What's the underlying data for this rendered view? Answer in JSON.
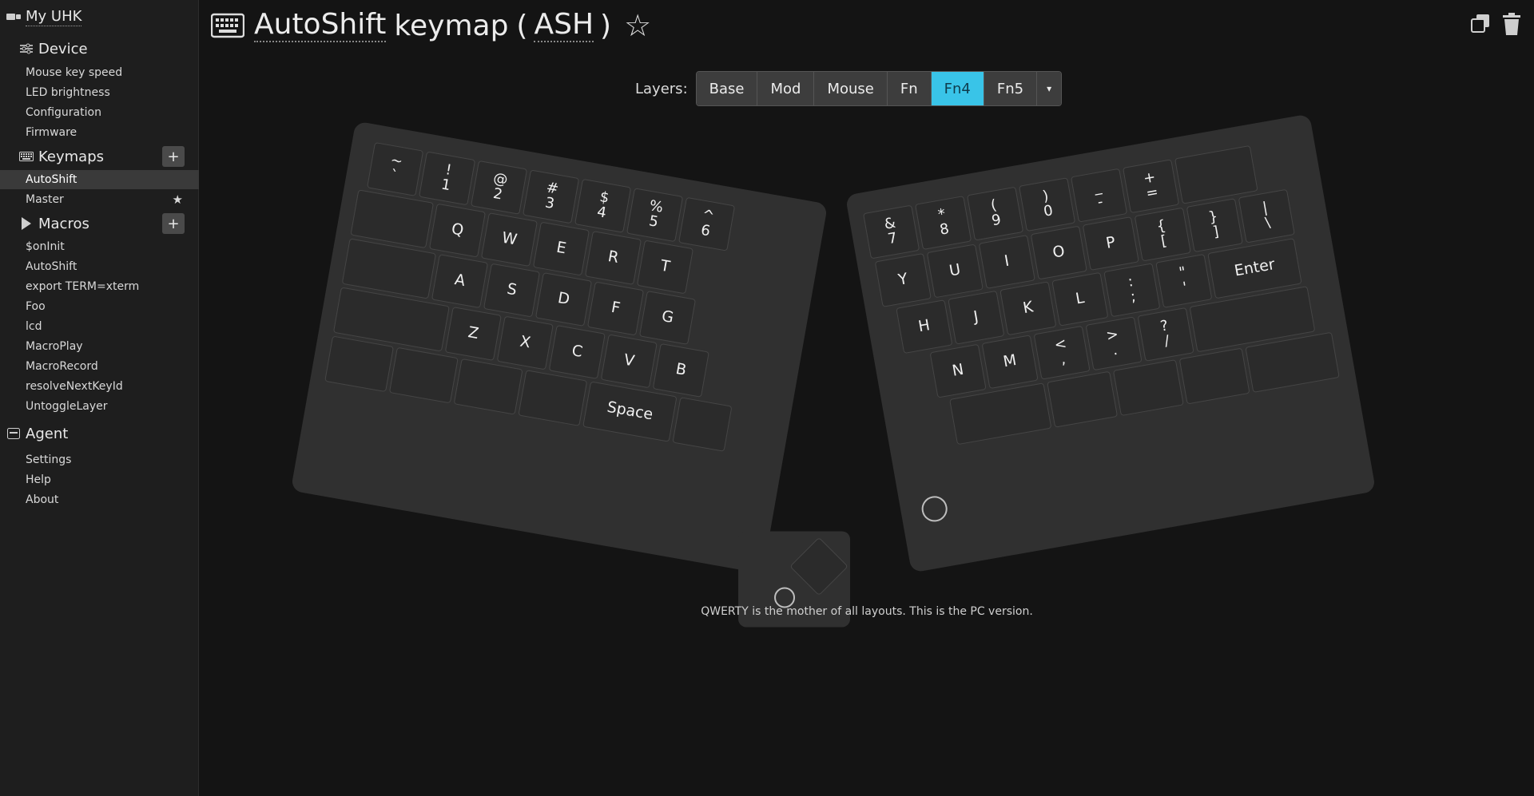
{
  "sidebar": {
    "device_title": "My UHK",
    "device_section": "Device",
    "device_items": [
      "Mouse key speed",
      "LED brightness",
      "Configuration",
      "Firmware"
    ],
    "keymaps_section": "Keymaps",
    "keymaps": [
      "AutoShift",
      "Master"
    ],
    "macros_section": "Macros",
    "macros": [
      "$onInit",
      "AutoShift",
      "export TERM=xterm",
      "Foo",
      "lcd",
      "MacroPlay",
      "MacroRecord",
      "resolveNextKeyId",
      "UntoggleLayer"
    ],
    "agent_section": "Agent",
    "agent_items": [
      "Settings",
      "Help",
      "About"
    ],
    "add_label": "+"
  },
  "header": {
    "name": "AutoShift",
    "word": "keymap",
    "open": "(",
    "abbr": "ASH",
    "close": ")"
  },
  "layers": {
    "label": "Layers:",
    "items": [
      "Base",
      "Mod",
      "Mouse",
      "Fn",
      "Fn4",
      "Fn5"
    ],
    "active": "Fn4",
    "caret": "▾"
  },
  "keyboard": {
    "left": {
      "row1": [
        [
          "~",
          "`"
        ],
        [
          "!",
          "1"
        ],
        [
          "@",
          "2"
        ],
        [
          "#",
          "3"
        ],
        [
          "$",
          "4"
        ],
        [
          "%",
          "5"
        ],
        [
          "^",
          "6"
        ]
      ],
      "row2": [
        "",
        "Q",
        "W",
        "E",
        "R",
        "T"
      ],
      "row3": [
        "",
        "A",
        "S",
        "D",
        "F",
        "G"
      ],
      "row4": [
        "",
        "Z",
        "X",
        "C",
        "V",
        "B"
      ],
      "row5": [
        "",
        "",
        "",
        "",
        "Space",
        ""
      ]
    },
    "right": {
      "row1": [
        [
          "&",
          "7"
        ],
        [
          "*",
          "8"
        ],
        [
          "(",
          "9"
        ],
        [
          ")",
          "0"
        ],
        [
          "_",
          "-"
        ],
        [
          "+",
          "="
        ],
        [
          "",
          ""
        ]
      ],
      "row2": [
        "Y",
        "U",
        "I",
        "O",
        "P",
        [
          "{",
          "["
        ],
        [
          "}",
          "]"
        ],
        [
          "|",
          "\\"
        ]
      ],
      "row3": [
        "H",
        "J",
        "K",
        "L",
        [
          ":",
          ";"
        ],
        [
          "\"",
          "'"
        ],
        "Enter"
      ],
      "row4": [
        "N",
        "M",
        [
          "<",
          ","
        ],
        [
          ">",
          "."
        ],
        [
          "?",
          "/"
        ],
        ""
      ]
    }
  },
  "description": "QWERTY is the mother of all layouts. This is the PC version.",
  "colors": {
    "accent": "#39c4e8",
    "background": "#141414",
    "sidebar": "#1e1e1e",
    "key": "#2b2b2b"
  }
}
